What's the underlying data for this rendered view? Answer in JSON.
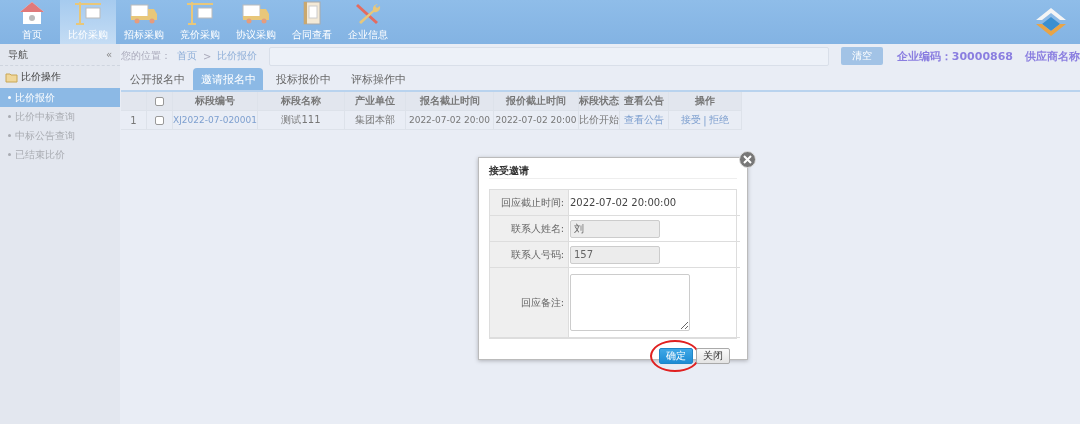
{
  "top_nav": [
    {
      "label": "首页",
      "selected": false
    },
    {
      "label": "比价采购",
      "selected": true
    },
    {
      "label": "招标采购",
      "selected": false
    },
    {
      "label": "竞价采购",
      "selected": false
    },
    {
      "label": "协议采购",
      "selected": false
    },
    {
      "label": "合同查看",
      "selected": false
    },
    {
      "label": "企业信息",
      "selected": false
    }
  ],
  "sidebar": {
    "title": "导航",
    "collapse": "«",
    "group": "比价操作",
    "items": [
      {
        "label": "比价报价",
        "selected": true
      },
      {
        "label": "比价中标查询",
        "selected": false
      },
      {
        "label": "中标公告查询",
        "selected": false
      },
      {
        "label": "已结束比价",
        "selected": false
      }
    ]
  },
  "breadcrumb": {
    "prefix": "您的位置：",
    "links": [
      "首页",
      "比价报价"
    ],
    "separator": ">"
  },
  "clear_button": "清空",
  "company": {
    "code_label": "企业编码：",
    "code": "30000868",
    "name_label": "供应商名称"
  },
  "tabs": [
    {
      "label": "公开报名中",
      "selected": false
    },
    {
      "label": "邀请报名中",
      "selected": true
    },
    {
      "label": "投标报价中",
      "selected": false
    },
    {
      "label": "评标操作中",
      "selected": false
    }
  ],
  "table": {
    "select_all_checked": false,
    "columns": [
      "",
      "",
      "标段编号",
      "标段名称",
      "产业单位",
      "报名截止时间",
      "报价截止时间",
      "标段状态",
      "查看公告",
      "操作"
    ],
    "rows": [
      {
        "index": "1",
        "checked": false,
        "code": "XJ2022-07-020001",
        "name": "测试111",
        "unit": "集团本部",
        "signup_deadline": "2022-07-02 20:00",
        "quote_deadline": "2022-07-02 20:00",
        "status": "比价开始",
        "notice": "查看公告",
        "actions": [
          "接受",
          "拒绝"
        ],
        "action_separator": "|"
      }
    ]
  },
  "dialog": {
    "title": "接受邀请",
    "fields": [
      {
        "label": "回应截止时间:",
        "kind": "text",
        "value": "2022-07-02 20:00:00"
      },
      {
        "label": "联系人姓名:",
        "kind": "input",
        "value": "刘"
      },
      {
        "label": "联系人号码:",
        "kind": "input",
        "value": "157"
      },
      {
        "label": "回应备注:",
        "kind": "textarea"
      }
    ],
    "buttons": [
      {
        "label": "确定",
        "primary": true,
        "circled": true
      },
      {
        "label": "关闭",
        "primary": false,
        "circled": false
      }
    ]
  }
}
